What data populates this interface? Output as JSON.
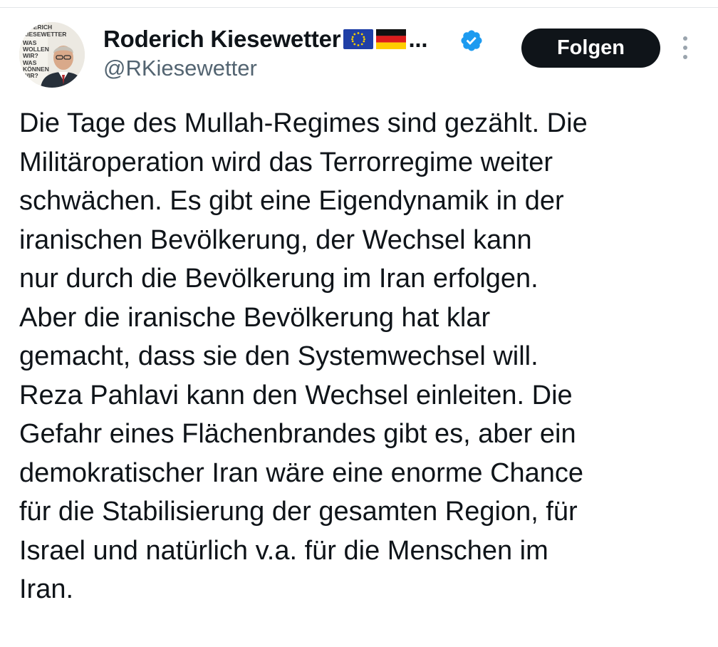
{
  "author": {
    "display_name": "Roderich Kiesewetter",
    "name_suffix": "...",
    "handle": "@RKiesewetter",
    "flags": [
      "eu-flag",
      "germany-flag"
    ],
    "verified": true,
    "avatar_poster_text": [
      "ODERICH",
      "KIESEWETTER",
      "WAS",
      "WOLLEN",
      "WIR?",
      "WAS",
      "KÖNNEN",
      "WIR?"
    ]
  },
  "follow_button": {
    "label": "Folgen"
  },
  "tweet": {
    "lines": [
      "Die Tage des Mullah-Regimes sind gezählt. Die",
      "Militäroperation wird das Terrorregime weiter",
      "schwächen. Es gibt eine Eigendynamik in der",
      "iranischen Bevölkerung, der Wechsel kann",
      "nur durch die Bevölkerung im Iran erfolgen.",
      "Aber die iranische Bevölkerung hat klar",
      "gemacht, dass sie den Systemwechsel will.",
      "Reza Pahlavi kann den Wechsel einleiten. Die",
      "Gefahr eines Flächenbrandes gibt es, aber ein",
      "demokratischer Iran wäre eine enorme Chance",
      "für die Stabilisierung der gesamten Region, für",
      "Israel und natürlich v.a. für die Menschen im",
      "Iran."
    ]
  },
  "colors": {
    "text": "#0f1419",
    "secondary": "#536471",
    "verified": "#1d9bf0",
    "button_bg": "#0f1419",
    "button_text": "#ffffff"
  },
  "icons": {
    "verified": "verified-badge-icon",
    "more": "more-options-icon"
  }
}
